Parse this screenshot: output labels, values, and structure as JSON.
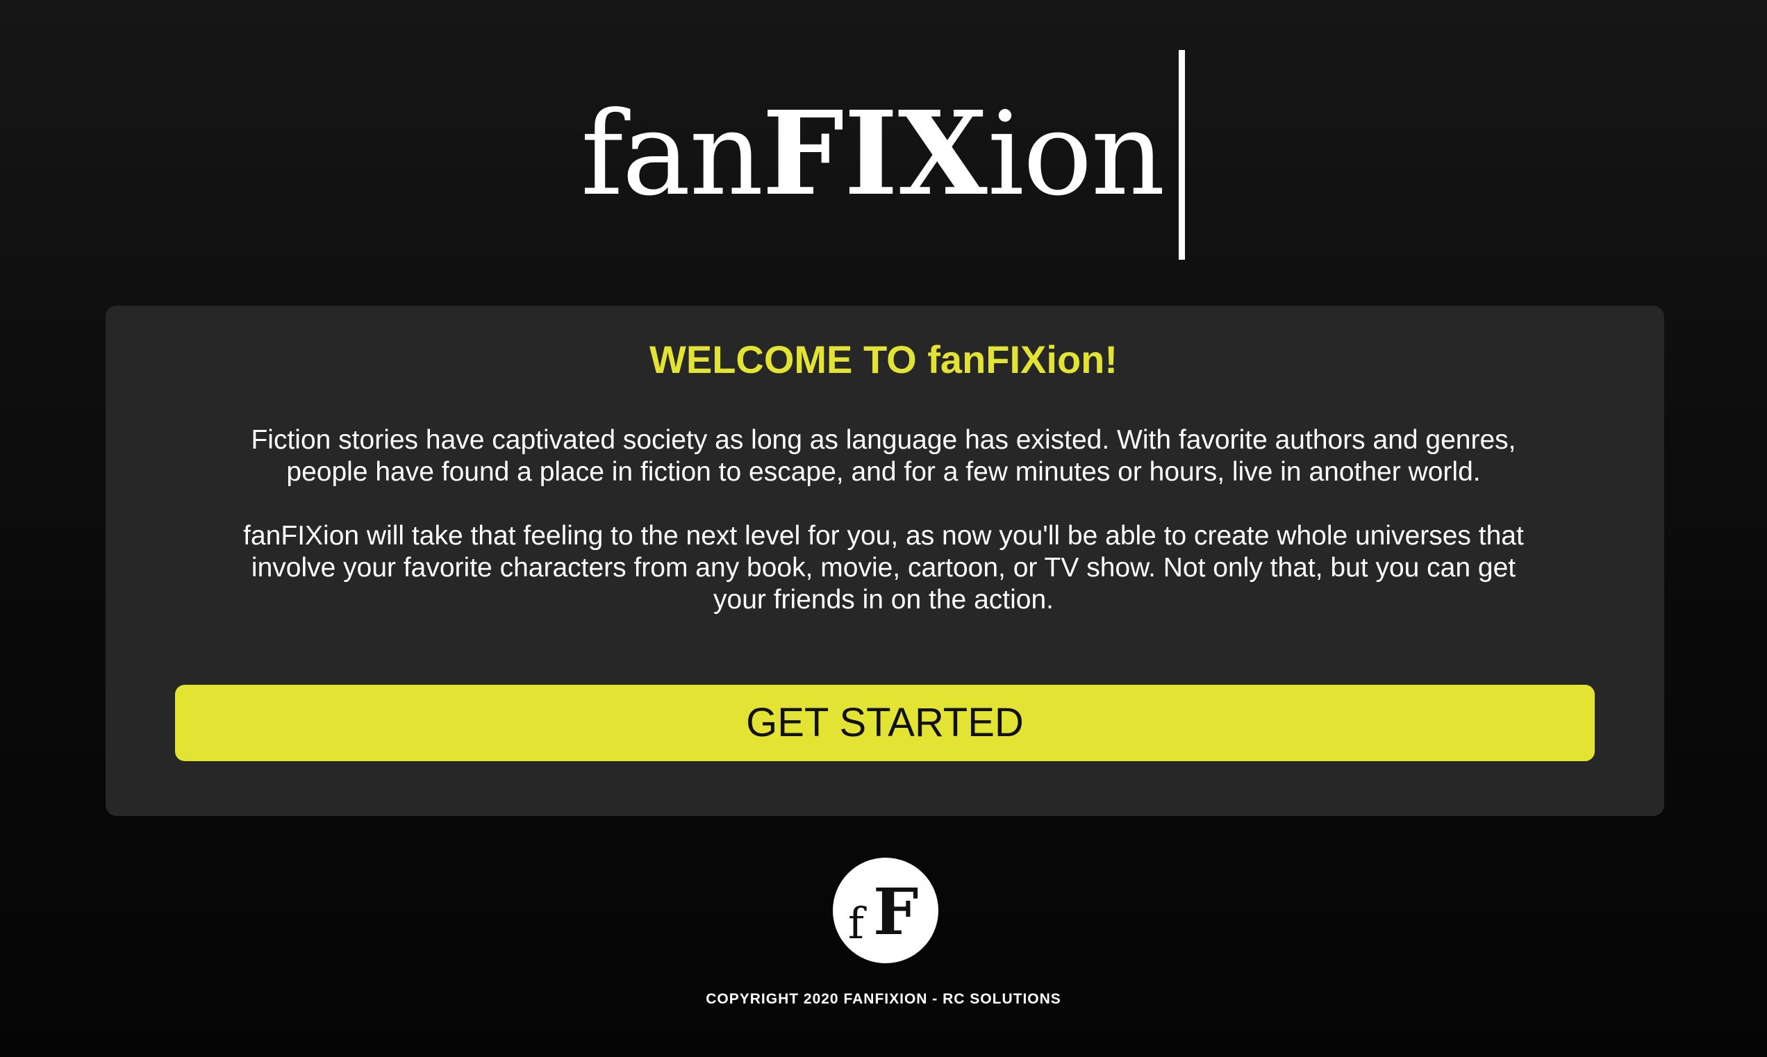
{
  "header": {
    "logo_prefix": "fan",
    "logo_bold": "FIX",
    "logo_suffix": "ion"
  },
  "welcome": {
    "title": "WELCOME TO fanFIXion!",
    "paragraph_1": "Fiction stories have captivated society as long as language has existed. With favorite authors and genres, people have found a place in fiction to escape, and for a few minutes or hours, live in another world.",
    "paragraph_2": "fanFIXion will take that feeling to the next level for you, as now you'll be able to create whole universes that involve your favorite characters from any book, movie, cartoon, or TV show. Not only that, but you can get your friends in on the action.",
    "cta_label": "GET STARTED"
  },
  "footer": {
    "logo_letter_small": "f",
    "logo_letter_big": "F",
    "copyright": "COPYRIGHT 2020 FANFIXION - RC SOLUTIONS"
  },
  "colors": {
    "accent": "#e3e334",
    "card_background": "#272727",
    "page_background": "#0c0c0c",
    "text": "#ffffff"
  }
}
